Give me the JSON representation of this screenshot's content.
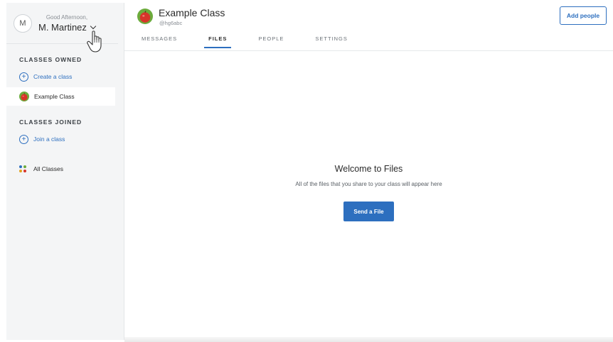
{
  "user": {
    "avatar_letter": "M",
    "greeting": "Good Afternoon,",
    "name": "M. Martinez"
  },
  "sidebar": {
    "classes_owned_title": "CLASSES OWNED",
    "create_class_label": "Create a class",
    "owned_classes": [
      {
        "label": "Example Class"
      }
    ],
    "classes_joined_title": "CLASSES JOINED",
    "join_class_label": "Join a class",
    "all_classes_label": "All Classes"
  },
  "header": {
    "class_title": "Example Class",
    "class_code": "@hg6abc",
    "add_people_label": "Add people",
    "tabs": [
      {
        "label": "MESSAGES",
        "active": false
      },
      {
        "label": "FILES",
        "active": true
      },
      {
        "label": "PEOPLE",
        "active": false
      },
      {
        "label": "SETTINGS",
        "active": false
      }
    ]
  },
  "main": {
    "empty_title": "Welcome to Files",
    "empty_description": "All of the files that you share to your class will appear here",
    "send_file_label": "Send a File"
  },
  "colors": {
    "accent": "#2d6fbf",
    "sidebar_bg": "#f4f5f6",
    "apple_red": "#d8342a",
    "apple_green": "#6cab3c"
  },
  "icons": {
    "class_avatar": "apple-icon",
    "create": "plus-circle-icon",
    "join": "plus-circle-icon",
    "all_classes": "grid-dots-icon",
    "user_menu": "chevron-down-icon",
    "cursor": "hand-pointer-icon"
  }
}
